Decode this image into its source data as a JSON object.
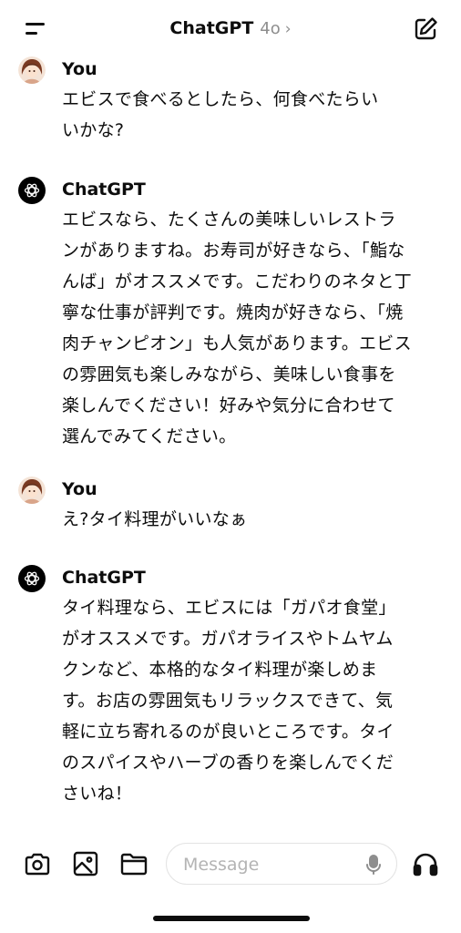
{
  "header": {
    "title": "ChatGPT",
    "model": "4o",
    "chevron": "›",
    "menu_icon": "hamburger-icon",
    "compose_icon": "compose-icon"
  },
  "messages": [
    {
      "sender": "You",
      "text": "エビスで食べるとしたら、何食べたらい\nいかな?"
    },
    {
      "sender": "ChatGPT",
      "text": "エビスなら、たくさんの美味しいレストラ\nンがありますね。お寿司が好きなら、「鮨な\nんば」がオススメです。こだわりのネタと丁\n寧な仕事が評判です。焼肉が好きなら、「焼\n肉チャンピオン」も人気があります。エビス\nの雰囲気も楽しみながら、美味しい食事を\n楽しんでください！好みや気分に合わせて\n選んでみてください。"
    },
    {
      "sender": "You",
      "text": "え?タイ料理がいいなぁ"
    },
    {
      "sender": "ChatGPT",
      "text": "タイ料理なら、エビスには「ガパオ食堂」\nがオススメです。ガパオライスやトムヤム\nクンなど、本格的なタイ料理が楽しめま\nす。お店の雰囲気もリラックスできて、気\n軽に立ち寄れるのが良いところです。タイ\nのスパイスやハーブの香りを楽しんでくだ\nさいね！"
    }
  ],
  "composer": {
    "placeholder": "Message",
    "icons": [
      "camera-icon",
      "image-icon",
      "folder-icon",
      "microphone-icon",
      "headphones-icon"
    ]
  }
}
